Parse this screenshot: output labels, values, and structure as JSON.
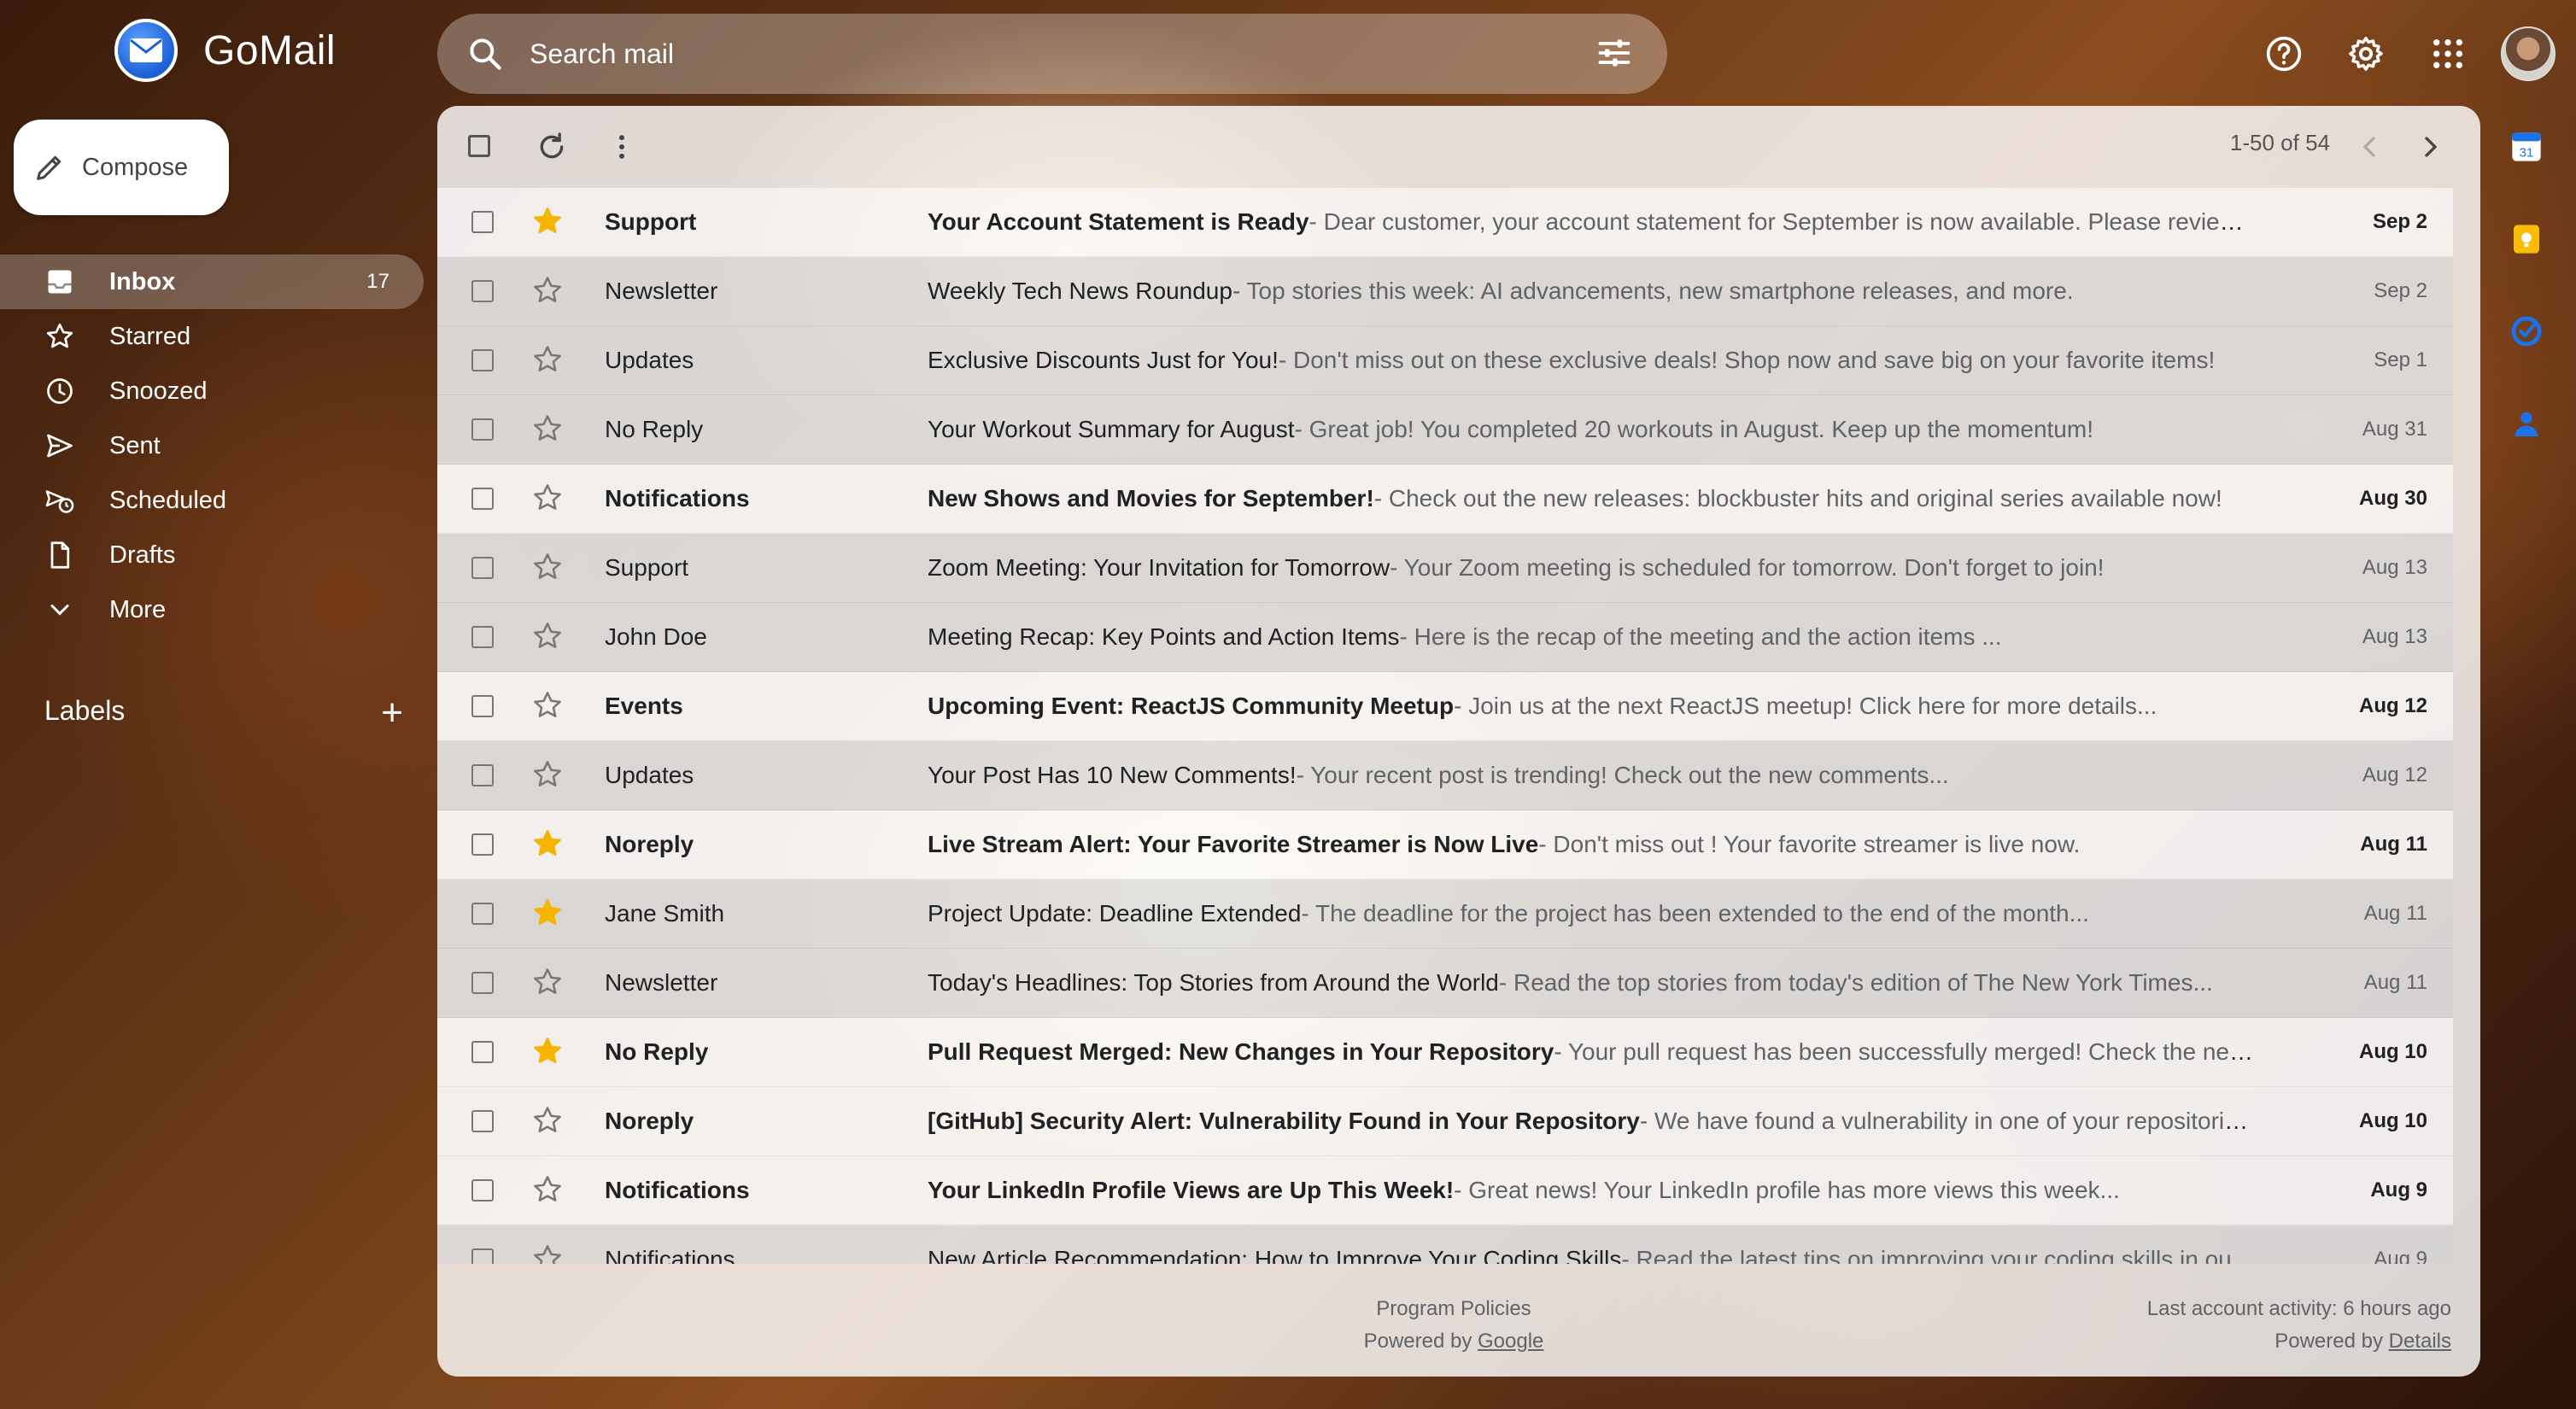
{
  "app": {
    "name": "GoMail"
  },
  "search": {
    "placeholder": "Search mail"
  },
  "compose": {
    "label": "Compose"
  },
  "nav": [
    {
      "label": "Inbox",
      "count": "17",
      "icon": "inbox-icon"
    },
    {
      "label": "Starred",
      "count": "",
      "icon": "star-icon"
    },
    {
      "label": "Snoozed",
      "count": "",
      "icon": "clock-icon"
    },
    {
      "label": "Sent",
      "count": "",
      "icon": "send-icon"
    },
    {
      "label": "Scheduled",
      "count": "",
      "icon": "scheduled-icon"
    },
    {
      "label": "Drafts",
      "count": "",
      "icon": "draft-icon"
    },
    {
      "label": "More",
      "count": "",
      "icon": "chevron-down-icon"
    }
  ],
  "labels": {
    "title": "Labels",
    "add": "+"
  },
  "toolbar": {
    "pagination": "1-50 of 54"
  },
  "emails": [
    {
      "sender": "Support",
      "subject": "Your Account Statement is Ready",
      "snippet": "- Dear customer, your account statement for September is now available. Please review it.",
      "date": "Sep 2",
      "starred": true,
      "unread": true
    },
    {
      "sender": "Newsletter",
      "subject": "Weekly Tech News Roundup",
      "snippet": "- Top stories this week: AI advancements, new smartphone releases, and more.",
      "date": "Sep 2",
      "starred": false,
      "unread": false
    },
    {
      "sender": "Updates",
      "subject": "Exclusive Discounts Just for You!",
      "snippet": "- Don't miss out on these exclusive deals! Shop now and save big on your favorite items!",
      "date": "Sep 1",
      "starred": false,
      "unread": false
    },
    {
      "sender": "No Reply",
      "subject": "Your Workout Summary for August",
      "snippet": "- Great job! You completed 20 workouts in August. Keep up the momentum!",
      "date": "Aug 31",
      "starred": false,
      "unread": false
    },
    {
      "sender": "Notifications",
      "subject": "New Shows and Movies for September!",
      "snippet": "- Check out the new releases: blockbuster hits and original series available now!",
      "date": "Aug 30",
      "starred": false,
      "unread": true
    },
    {
      "sender": "Support",
      "subject": "Zoom Meeting: Your Invitation for Tomorrow",
      "snippet": "- Your Zoom meeting is scheduled for tomorrow. Don't forget to join!",
      "date": "Aug 13",
      "starred": false,
      "unread": false
    },
    {
      "sender": "John Doe",
      "subject": "Meeting Recap: Key Points and Action Items",
      "snippet": "- Here is the recap of the meeting and the action items ...",
      "date": "Aug 13",
      "starred": false,
      "unread": false
    },
    {
      "sender": "Events",
      "subject": "Upcoming Event: ReactJS Community Meetup",
      "snippet": "- Join us at the next ReactJS meetup! Click here for more details...",
      "date": "Aug 12",
      "starred": false,
      "unread": true
    },
    {
      "sender": "Updates",
      "subject": "Your Post Has 10 New Comments!",
      "snippet": "- Your recent post is trending! Check out the new comments...",
      "date": "Aug 12",
      "starred": false,
      "unread": false
    },
    {
      "sender": "Noreply",
      "subject": "Live Stream Alert: Your Favorite Streamer is Now Live",
      "snippet": "- Don't miss out ! Your favorite streamer is live now.",
      "date": "Aug 11",
      "starred": true,
      "unread": true
    },
    {
      "sender": "Jane Smith",
      "subject": "Project Update: Deadline Extended",
      "snippet": "- The deadline for the project has been extended to the end of the month...",
      "date": "Aug 11",
      "starred": true,
      "unread": false
    },
    {
      "sender": "Newsletter",
      "subject": "Today's Headlines: Top Stories from Around the World",
      "snippet": "- Read the top stories from today's edition of The New York Times...",
      "date": "Aug 11",
      "starred": false,
      "unread": false
    },
    {
      "sender": "No Reply",
      "subject": "Pull Request Merged: New Changes in Your Repository",
      "snippet": "- Your pull request has been successfully merged! Check the new up...",
      "date": "Aug 10",
      "starred": true,
      "unread": true
    },
    {
      "sender": "Noreply",
      "subject": "[GitHub] Security Alert: Vulnerability Found in Your Repository",
      "snippet": "- We have found a vulnerability in one of your repositories. Ple...",
      "date": "Aug 10",
      "starred": false,
      "unread": true
    },
    {
      "sender": "Notifications",
      "subject": "Your LinkedIn Profile Views are Up This Week!",
      "snippet": "- Great news! Your LinkedIn profile has more views this week...",
      "date": "Aug 9",
      "starred": false,
      "unread": true
    },
    {
      "sender": "Notifications",
      "subject": "New Article Recommendation: How to Improve Your Coding Skills",
      "snippet": "- Read the latest tips on improving your coding skills in ou...",
      "date": "Aug 9",
      "starred": false,
      "unread": false
    }
  ],
  "footer": {
    "policies": "Program Policies",
    "powered_prefix": "Powered by ",
    "powered_link": "Google",
    "last_activity": "Last account activity: 6 hours ago",
    "details_prefix": "Powered by ",
    "details_link": "Details"
  },
  "colors": {
    "star": "#f4b400",
    "accent": "#1a73e8"
  }
}
